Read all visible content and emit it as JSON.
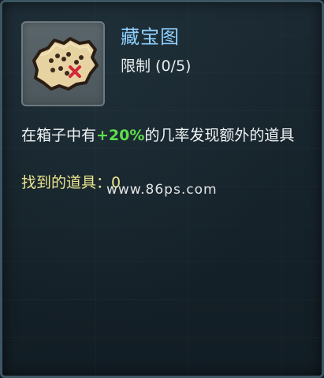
{
  "item": {
    "icon": "treasure-map-icon",
    "title": "藏宝图",
    "limit": "限制 (0/5)",
    "description": {
      "prefix": "在箱子中有",
      "highlight": "+20%",
      "suffix": "的几率发现额外的道具"
    },
    "found_items": "找到的道具：0"
  },
  "watermark": "www.86ps.com",
  "colors": {
    "title": "#8fd0ff",
    "highlight": "#5dde4c",
    "found": "#ece58c",
    "text": "#f0f3f4"
  }
}
